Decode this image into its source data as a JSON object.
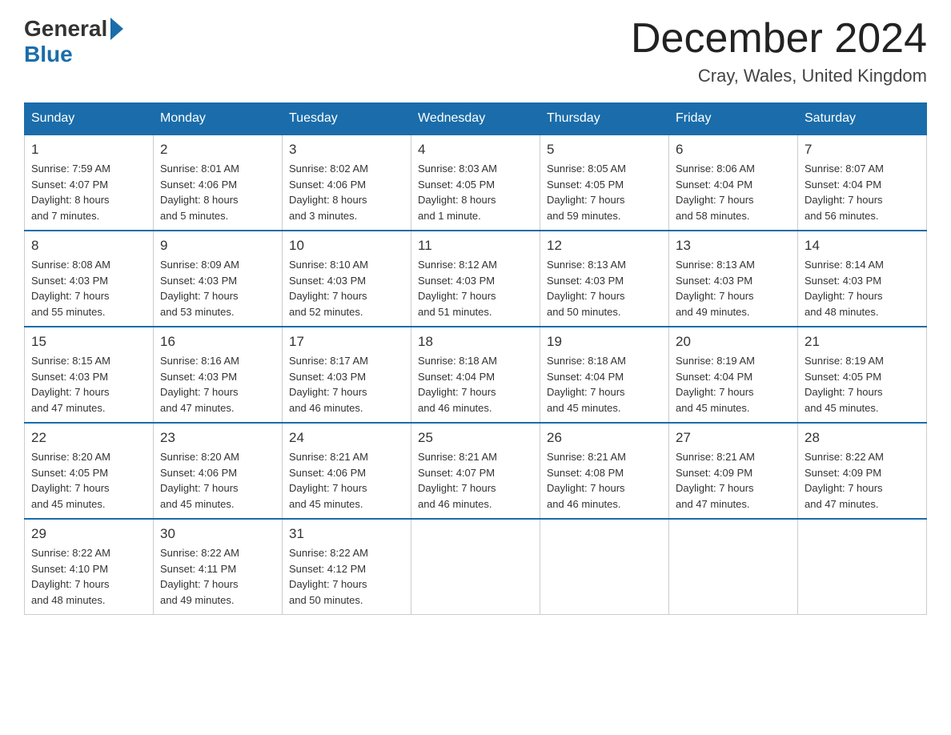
{
  "header": {
    "logo_general": "General",
    "logo_blue": "Blue",
    "month_title": "December 2024",
    "location": "Cray, Wales, United Kingdom"
  },
  "days_of_week": [
    "Sunday",
    "Monday",
    "Tuesday",
    "Wednesday",
    "Thursday",
    "Friday",
    "Saturday"
  ],
  "weeks": [
    [
      {
        "day": "1",
        "info": "Sunrise: 7:59 AM\nSunset: 4:07 PM\nDaylight: 8 hours\nand 7 minutes."
      },
      {
        "day": "2",
        "info": "Sunrise: 8:01 AM\nSunset: 4:06 PM\nDaylight: 8 hours\nand 5 minutes."
      },
      {
        "day": "3",
        "info": "Sunrise: 8:02 AM\nSunset: 4:06 PM\nDaylight: 8 hours\nand 3 minutes."
      },
      {
        "day": "4",
        "info": "Sunrise: 8:03 AM\nSunset: 4:05 PM\nDaylight: 8 hours\nand 1 minute."
      },
      {
        "day": "5",
        "info": "Sunrise: 8:05 AM\nSunset: 4:05 PM\nDaylight: 7 hours\nand 59 minutes."
      },
      {
        "day": "6",
        "info": "Sunrise: 8:06 AM\nSunset: 4:04 PM\nDaylight: 7 hours\nand 58 minutes."
      },
      {
        "day": "7",
        "info": "Sunrise: 8:07 AM\nSunset: 4:04 PM\nDaylight: 7 hours\nand 56 minutes."
      }
    ],
    [
      {
        "day": "8",
        "info": "Sunrise: 8:08 AM\nSunset: 4:03 PM\nDaylight: 7 hours\nand 55 minutes."
      },
      {
        "day": "9",
        "info": "Sunrise: 8:09 AM\nSunset: 4:03 PM\nDaylight: 7 hours\nand 53 minutes."
      },
      {
        "day": "10",
        "info": "Sunrise: 8:10 AM\nSunset: 4:03 PM\nDaylight: 7 hours\nand 52 minutes."
      },
      {
        "day": "11",
        "info": "Sunrise: 8:12 AM\nSunset: 4:03 PM\nDaylight: 7 hours\nand 51 minutes."
      },
      {
        "day": "12",
        "info": "Sunrise: 8:13 AM\nSunset: 4:03 PM\nDaylight: 7 hours\nand 50 minutes."
      },
      {
        "day": "13",
        "info": "Sunrise: 8:13 AM\nSunset: 4:03 PM\nDaylight: 7 hours\nand 49 minutes."
      },
      {
        "day": "14",
        "info": "Sunrise: 8:14 AM\nSunset: 4:03 PM\nDaylight: 7 hours\nand 48 minutes."
      }
    ],
    [
      {
        "day": "15",
        "info": "Sunrise: 8:15 AM\nSunset: 4:03 PM\nDaylight: 7 hours\nand 47 minutes."
      },
      {
        "day": "16",
        "info": "Sunrise: 8:16 AM\nSunset: 4:03 PM\nDaylight: 7 hours\nand 47 minutes."
      },
      {
        "day": "17",
        "info": "Sunrise: 8:17 AM\nSunset: 4:03 PM\nDaylight: 7 hours\nand 46 minutes."
      },
      {
        "day": "18",
        "info": "Sunrise: 8:18 AM\nSunset: 4:04 PM\nDaylight: 7 hours\nand 46 minutes."
      },
      {
        "day": "19",
        "info": "Sunrise: 8:18 AM\nSunset: 4:04 PM\nDaylight: 7 hours\nand 45 minutes."
      },
      {
        "day": "20",
        "info": "Sunrise: 8:19 AM\nSunset: 4:04 PM\nDaylight: 7 hours\nand 45 minutes."
      },
      {
        "day": "21",
        "info": "Sunrise: 8:19 AM\nSunset: 4:05 PM\nDaylight: 7 hours\nand 45 minutes."
      }
    ],
    [
      {
        "day": "22",
        "info": "Sunrise: 8:20 AM\nSunset: 4:05 PM\nDaylight: 7 hours\nand 45 minutes."
      },
      {
        "day": "23",
        "info": "Sunrise: 8:20 AM\nSunset: 4:06 PM\nDaylight: 7 hours\nand 45 minutes."
      },
      {
        "day": "24",
        "info": "Sunrise: 8:21 AM\nSunset: 4:06 PM\nDaylight: 7 hours\nand 45 minutes."
      },
      {
        "day": "25",
        "info": "Sunrise: 8:21 AM\nSunset: 4:07 PM\nDaylight: 7 hours\nand 46 minutes."
      },
      {
        "day": "26",
        "info": "Sunrise: 8:21 AM\nSunset: 4:08 PM\nDaylight: 7 hours\nand 46 minutes."
      },
      {
        "day": "27",
        "info": "Sunrise: 8:21 AM\nSunset: 4:09 PM\nDaylight: 7 hours\nand 47 minutes."
      },
      {
        "day": "28",
        "info": "Sunrise: 8:22 AM\nSunset: 4:09 PM\nDaylight: 7 hours\nand 47 minutes."
      }
    ],
    [
      {
        "day": "29",
        "info": "Sunrise: 8:22 AM\nSunset: 4:10 PM\nDaylight: 7 hours\nand 48 minutes."
      },
      {
        "day": "30",
        "info": "Sunrise: 8:22 AM\nSunset: 4:11 PM\nDaylight: 7 hours\nand 49 minutes."
      },
      {
        "day": "31",
        "info": "Sunrise: 8:22 AM\nSunset: 4:12 PM\nDaylight: 7 hours\nand 50 minutes."
      },
      {
        "day": "",
        "info": ""
      },
      {
        "day": "",
        "info": ""
      },
      {
        "day": "",
        "info": ""
      },
      {
        "day": "",
        "info": ""
      }
    ]
  ]
}
